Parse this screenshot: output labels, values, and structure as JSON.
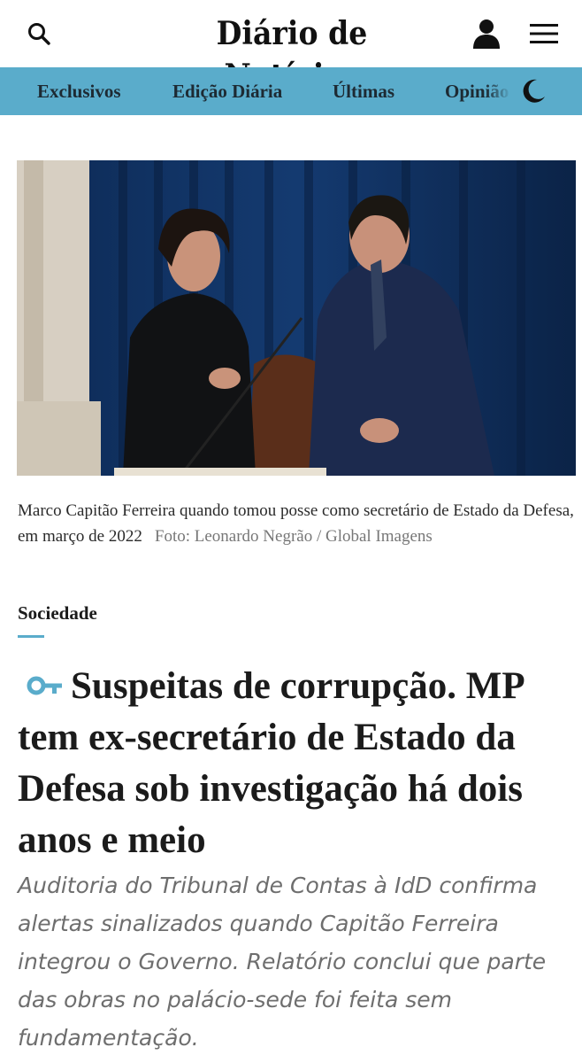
{
  "header": {
    "logo": "Diário de Notícias",
    "icons": {
      "search": "search-icon",
      "user": "user-icon",
      "menu": "menu-icon"
    }
  },
  "nav": {
    "items": [
      "Exclusivos",
      "Edição Diária",
      "Últimas",
      "Opinião"
    ],
    "dark_mode_icon": "moon-icon"
  },
  "article": {
    "photo_caption": "Marco Capitão Ferreira quando tomou posse como secretário de Estado da Defesa, em março de 2022",
    "photo_credit": "Foto: Leonardo Negrão / Global Imagens",
    "section": "Sociedade",
    "premium_icon": "key-icon",
    "headline": "Suspeitas de corrupção. MP tem ex-secretário de Estado da Defesa sob investigação há dois anos e meio",
    "lede": "Auditoria do Tribunal de Contas à IdD confirma alertas sinalizados quando Capitão Ferreira integrou o Governo. Relatório conclui que parte das obras no palácio-sede foi feita sem fundamentação."
  },
  "colors": {
    "nav_background": "#5aaccb",
    "accent": "#5aaccb",
    "text": "#1b1b1b",
    "lede": "#6e6e6e"
  }
}
